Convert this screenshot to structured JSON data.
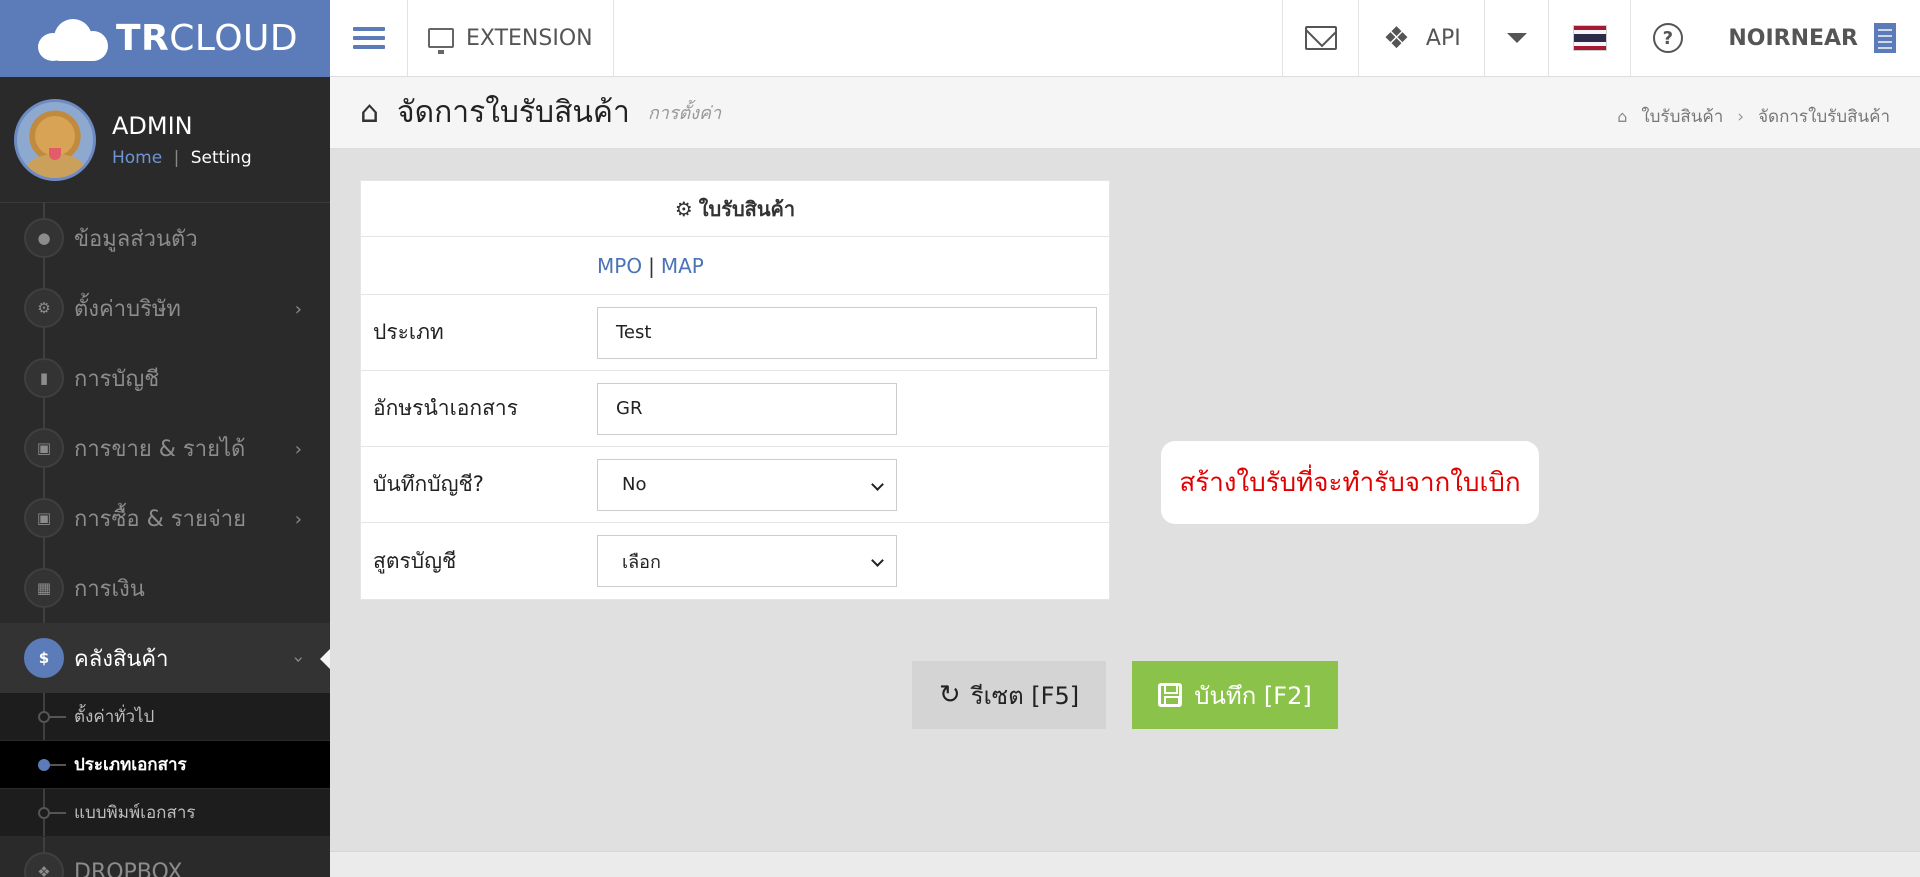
{
  "brand": {
    "name_bold": "TR",
    "name_light": "CLOUD"
  },
  "profile": {
    "name": "ADMIN",
    "home_link": "Home",
    "separator": "|",
    "setting_link": "Setting"
  },
  "sidebar": {
    "items": [
      {
        "label": "ข้อมูลส่วนตัว",
        "icon": "user-icon"
      },
      {
        "label": "ตั้งค่าบริษัท",
        "icon": "gear-icon"
      },
      {
        "label": "การบัญชี",
        "icon": "book-icon"
      },
      {
        "label": "การขาย & รายได้",
        "icon": "cart-icon"
      },
      {
        "label": "การซื้อ & รายจ่าย",
        "icon": "cart-icon"
      },
      {
        "label": "การเงิน",
        "icon": "calendar-icon"
      },
      {
        "label": "คลังสินค้า",
        "icon": "dollar-icon"
      }
    ],
    "subitems": [
      {
        "label": "ตั้งค่าทั่วไป"
      },
      {
        "label": "ประเภทเอกสาร"
      },
      {
        "label": "แบบพิมพ์เอกสาร"
      }
    ],
    "bottom_item": {
      "label": "DROPBOX",
      "icon": "dropbox-icon"
    }
  },
  "topbar": {
    "extension_label": "EXTENSION",
    "api_label": "API",
    "company_name": "NOIRNEAR",
    "flag_colors": [
      "#a51931",
      "#f4f5f8",
      "#2d2a4a",
      "#2d2a4a",
      "#f4f5f8",
      "#a51931"
    ]
  },
  "header": {
    "title": "จัดการใบรับสินค้า",
    "subtitle": "การตั้งค่า",
    "breadcrumb": [
      "ใบรับสินค้า",
      "จัดการใบรับสินค้า"
    ]
  },
  "form": {
    "heading": "ใบรับสินค้า",
    "link_mpo": "MPO",
    "link_sep": "|",
    "link_map": "MAP",
    "fields": {
      "type_label": "ประเภท",
      "type_value": "Test",
      "prefix_label": "อักษรนำเอกสาร",
      "prefix_value": "GR",
      "record_label": "บันทึกบัญชี?",
      "record_value": "No",
      "formula_label": "สูตรบัญชี",
      "formula_value": "เลือก"
    }
  },
  "notice": "สร้างใบรับที่จะทำรับจากใบเบิก",
  "buttons": {
    "reset": "รีเซต [F5]",
    "save": "บันทึก [F2]"
  },
  "colors": {
    "accent": "#5b7cb8",
    "save": "#8bc34a",
    "notice_text": "#e00000"
  }
}
